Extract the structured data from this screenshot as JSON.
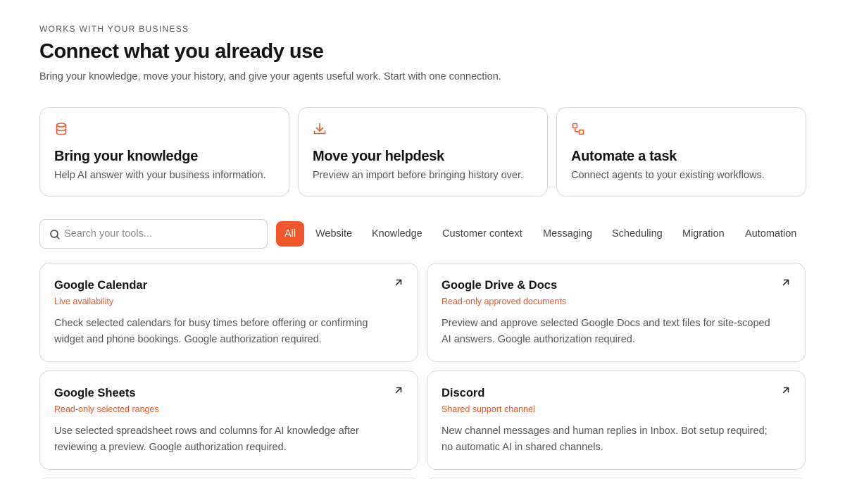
{
  "header": {
    "eyebrow": "WORKS WITH YOUR BUSINESS",
    "title": "Connect what you already use",
    "subtitle": "Bring your knowledge, move your history, and give your agents useful work. Start with one connection."
  },
  "features": [
    {
      "icon": "database-icon",
      "title": "Bring your knowledge",
      "desc": "Help AI answer with your business information."
    },
    {
      "icon": "download-icon",
      "title": "Move your helpdesk",
      "desc": "Preview an import before bringing history over."
    },
    {
      "icon": "workflow-icon",
      "title": "Automate a task",
      "desc": "Connect agents to your existing workflows."
    }
  ],
  "search": {
    "placeholder": "Search your tools...",
    "value": ""
  },
  "filters": [
    "All",
    "Website",
    "Knowledge",
    "Customer context",
    "Messaging",
    "Scheduling",
    "Migration",
    "Automation"
  ],
  "active_filter": "All",
  "integrations": [
    {
      "name": "Google Calendar",
      "tag": "Live availability",
      "desc": "Check selected calendars for busy times before offering or confirming widget and phone bookings. Google authorization required."
    },
    {
      "name": "Google Drive & Docs",
      "tag": "Read-only approved documents",
      "desc": "Preview and approve selected Google Docs and text files for site-scoped AI answers. Google authorization required."
    },
    {
      "name": "Google Sheets",
      "tag": "Read-only selected ranges",
      "desc": "Use selected spreadsheet rows and columns for AI knowledge after reviewing a preview. Google authorization required."
    },
    {
      "name": "Discord",
      "tag": "Shared support channel",
      "desc": "New channel messages and human replies in Inbox. Bot setup required; no automatic AI in shared channels."
    }
  ],
  "colors": {
    "accent": "#f0572a",
    "tag": "#e8572a",
    "border": "#d9d9d9",
    "muted": "#555555"
  }
}
